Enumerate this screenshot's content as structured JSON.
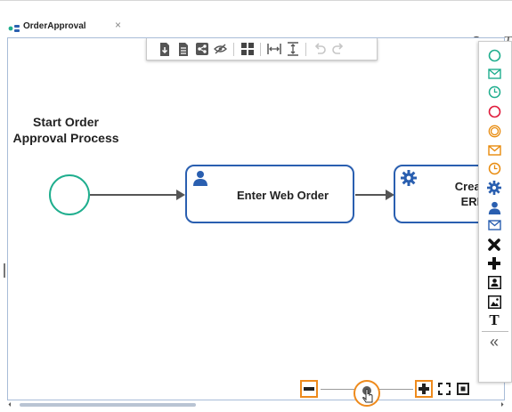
{
  "tab": {
    "title": "OrderApproval",
    "close_glyph": "×"
  },
  "top_icons": [
    "search-icon",
    "eye-icon",
    "text-tool-icon"
  ],
  "toolbar": {
    "buttons": [
      "export-icon",
      "document-icon",
      "share-icon",
      "hide-icon",
      "grid-icon",
      "fit-width-icon",
      "fit-height-icon",
      "undo-icon",
      "redo-icon"
    ]
  },
  "diagram": {
    "start_label_line1": "Start Order",
    "start_label_line2": "Approval Process",
    "task1_label": "Enter Web Order",
    "task2_label_line1": "Create",
    "task2_label_line2": "ERP"
  },
  "palette": {
    "items": [
      "start-event-icon",
      "message-start-icon",
      "timer-start-icon",
      "end-event-icon",
      "intermediate-event-icon",
      "intermediate-message-icon",
      "intermediate-timer-icon",
      "service-task-icon",
      "user-task-icon",
      "send-task-icon",
      "exclusive-gateway-icon",
      "parallel-gateway-icon",
      "subprocess-icon",
      "image-icon",
      "text-icon",
      "collapse-icon"
    ],
    "text_glyph": "T",
    "collapse_glyph": "«"
  },
  "colors": {
    "teal": "#1fae8e",
    "red": "#e0193a",
    "orange": "#e88a0c",
    "blue": "#2a5fb0",
    "dark": "#222222",
    "highlight": "#ee8a1c"
  },
  "zoom": {
    "level": 0.5
  }
}
